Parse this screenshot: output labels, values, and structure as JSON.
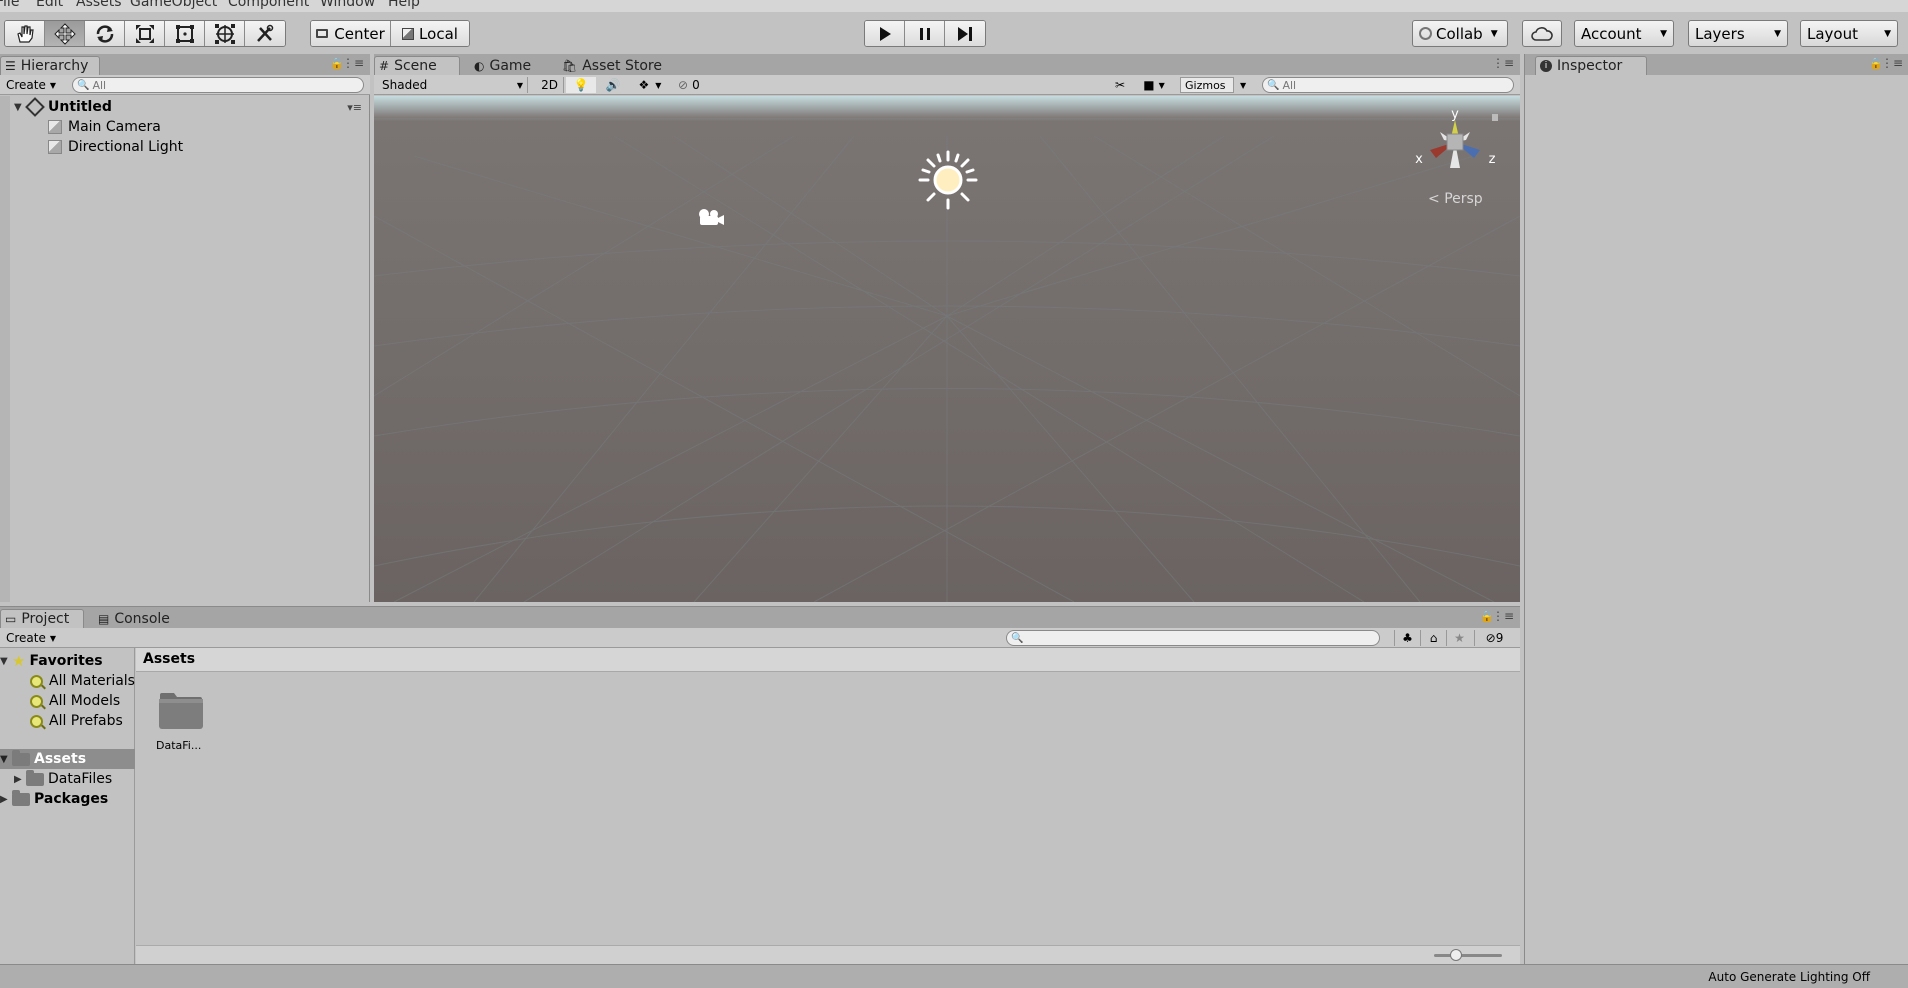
{
  "menu": [
    "File",
    "Edit",
    "Assets",
    "GameObject",
    "Component",
    "Window",
    "Help"
  ],
  "toolbar": {
    "tools": [
      "hand-tool",
      "move-tool",
      "rotate-tool",
      "scale-tool",
      "rect-tool",
      "transform-tool",
      "custom-tool"
    ],
    "active_tool": "move-tool",
    "pivot_label": "Center",
    "space_label": "Local",
    "collab_label": "Collab",
    "account_label": "Account",
    "layers_label": "Layers",
    "layout_label": "Layout"
  },
  "hierarchy": {
    "tab_label": "Hierarchy",
    "create_label": "Create",
    "search_placeholder": "All",
    "scene_name": "Untitled",
    "items": [
      "Main Camera",
      "Directional Light"
    ]
  },
  "scene": {
    "tabs": [
      "Scene",
      "Game",
      "Asset Store"
    ],
    "shading_mode": "Shaded",
    "mode_2d_label": "2D",
    "hidden_count": "0",
    "gizmos_label": "Gizmos",
    "search_placeholder": "All",
    "gizmo_axes": {
      "x": "x",
      "y": "y",
      "z": "z"
    },
    "projection_label": "Persp"
  },
  "inspector": {
    "tab_label": "Inspector"
  },
  "project": {
    "tabs": [
      "Project",
      "Console"
    ],
    "create_label": "Create",
    "favorites_label": "Favorites",
    "favorites": [
      "All Materials",
      "All Models",
      "All Prefabs"
    ],
    "assets_label": "Assets",
    "asset_children": [
      "DataFiles"
    ],
    "packages_label": "Packages",
    "breadcrumb": "Assets",
    "grid_items": [
      "DataFi..."
    ],
    "hidden_packages_count": "9"
  },
  "status": {
    "lighting": "Auto Generate Lighting Off"
  }
}
